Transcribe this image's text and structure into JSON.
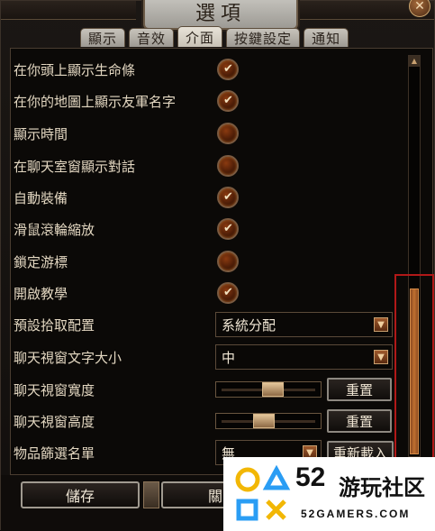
{
  "window": {
    "title": "選項",
    "close_glyph": "✕"
  },
  "tabs": [
    {
      "label": "顯示",
      "active": false
    },
    {
      "label": "音效",
      "active": false
    },
    {
      "label": "介面",
      "active": true
    },
    {
      "label": "按鍵設定",
      "active": false
    },
    {
      "label": "通知",
      "active": false
    }
  ],
  "options": {
    "checkboxes": [
      {
        "label": "在你頭上顯示生命條",
        "checked": true
      },
      {
        "label": "在你的地圖上顯示友軍名字",
        "checked": true
      },
      {
        "label": "顯示時間",
        "checked": false
      },
      {
        "label": "在聊天室窗顯示對話",
        "checked": false
      },
      {
        "label": "自動裝備",
        "checked": true
      },
      {
        "label": "滑鼠滾輪縮放",
        "checked": true
      },
      {
        "label": "鎖定游標",
        "checked": false
      },
      {
        "label": "開啟教學",
        "checked": true
      }
    ],
    "check_glyph": "✔",
    "loot_preset": {
      "label": "預設拾取配置",
      "value": "系統分配"
    },
    "chat_font_size": {
      "label": "聊天視窗文字大小",
      "value": "中"
    },
    "chat_width": {
      "label": "聊天視窗寬度",
      "level": 0.55,
      "button": "重置"
    },
    "chat_height": {
      "label": "聊天視窗高度",
      "level": 0.45,
      "button": "重置"
    },
    "item_filter": {
      "label": "物品篩選名單",
      "value": "無",
      "button": "重新載入"
    }
  },
  "footer": {
    "save_label": "儲存",
    "close_label": "關"
  },
  "watermark": {
    "number": "52",
    "name": "游玩社区",
    "domain": "52GAMERS.COM"
  },
  "colors": {
    "accent": "#c07030",
    "highlight_border": "#b01818",
    "text": "#e3d7c1"
  }
}
